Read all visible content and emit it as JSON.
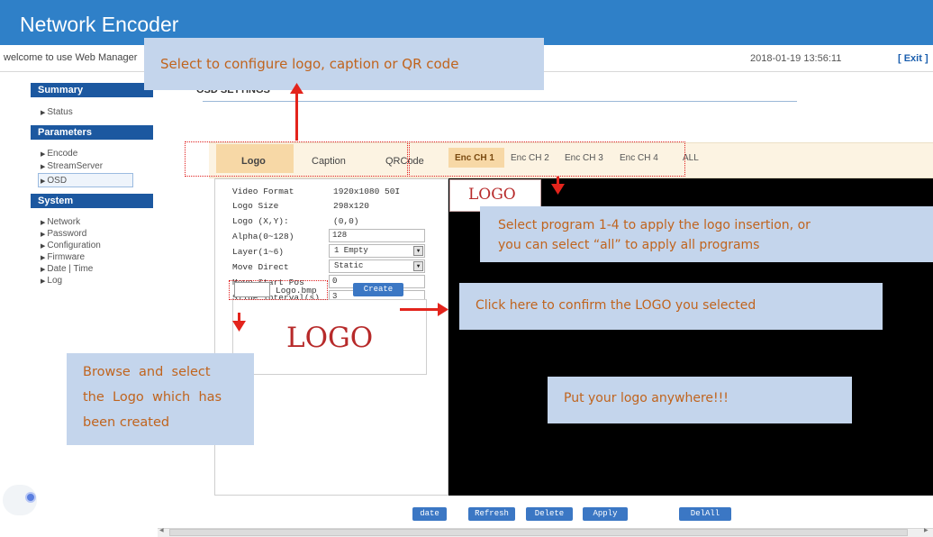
{
  "header": {
    "title": "Network Encoder",
    "welcome": "welcome to use Web Manager",
    "datetime": "2018-01-19 13:56:11",
    "exit_label": "[ Exit ]"
  },
  "sidebar": {
    "sections": [
      {
        "title": "Summary",
        "items": [
          "Status"
        ]
      },
      {
        "title": "Parameters",
        "items": [
          "Encode",
          "StreamServer",
          "OSD"
        ]
      },
      {
        "title": "System",
        "items": [
          "Network",
          "Password",
          "Configuration",
          "Firmware",
          "Date | Time",
          "Log"
        ]
      }
    ],
    "active_item": "OSD"
  },
  "page": {
    "title": "OSD SETTINGS",
    "tabs": [
      "Logo",
      "Caption",
      "QRCode"
    ],
    "active_tab": "Logo",
    "channel_tabs": [
      "Enc CH 1",
      "Enc CH 2",
      "Enc CH 3",
      "Enc CH 4",
      "ALL"
    ],
    "active_channel": "Enc CH 1"
  },
  "settings": {
    "video_format": {
      "label": "Video Format",
      "value": "1920x1080 50I"
    },
    "logo_size": {
      "label": "Logo Size",
      "value": "298x120"
    },
    "logo_xy": {
      "label": "Logo (X,Y):",
      "value": "(0,0)"
    },
    "alpha": {
      "label": "Alpha(0~128)",
      "value": "128"
    },
    "layer": {
      "label": "Layer(1~6)",
      "value": "1 Empty"
    },
    "move_direct": {
      "label": "Move Direct",
      "value": "Static"
    },
    "move_start_pos": {
      "label": "Move Start Pos",
      "value": "0"
    },
    "slide_interval": {
      "label": "Slide Interval(s)",
      "value": "3"
    },
    "file_name": "Logo.bmp",
    "create_label": "Create"
  },
  "preview": {
    "logo_text": "LOGO",
    "mini_logo_text": "LOGO"
  },
  "bottom_buttons": [
    "date",
    "Refresh",
    "Delete",
    "Apply",
    "DelAll"
  ],
  "annotations": {
    "select_config": "Select to configure logo, caption or QR code",
    "select_program_line1": "Select program 1-4 to apply the logo insertion, or",
    "select_program_line2": "you can select “all” to apply all programs",
    "click_confirm": "Click here to confirm the LOGO you selected",
    "browse_line1": "Browse  and  select",
    "browse_line2": "the  Logo  which  has",
    "browse_line3": "been created",
    "put_logo": "Put your logo anywhere!!!"
  },
  "colors": {
    "header_blue": "#2f80c8",
    "section_blue": "#1c58a0",
    "button_blue": "#3b77c4",
    "tab_highlight": "#f7d8a6",
    "callout_bg": "#c4d5ec",
    "callout_text": "#c0641e",
    "annotation_red": "#e3241c",
    "logo_red": "#b72a2a"
  },
  "icons": {
    "nav_bullet": "triangle-right",
    "select_dropdown": "triangle-down"
  }
}
